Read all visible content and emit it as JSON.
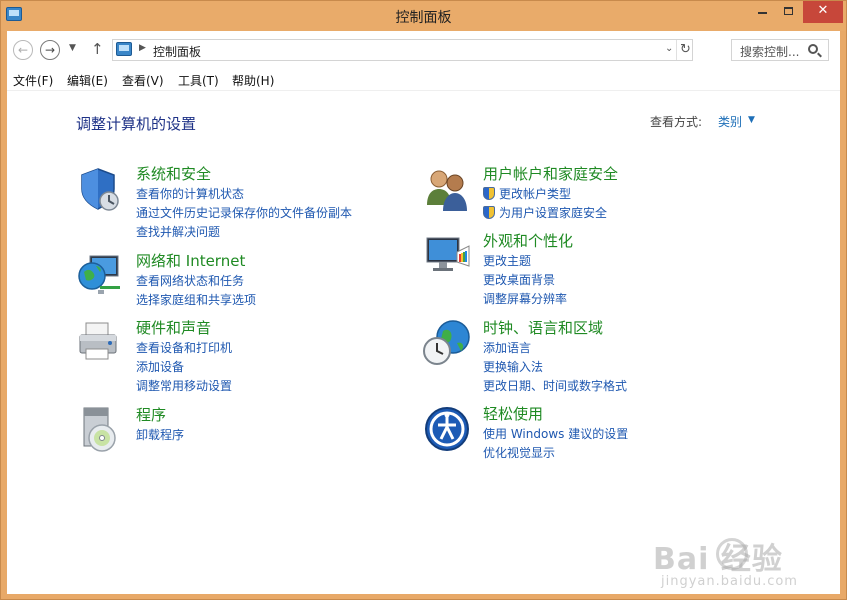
{
  "window": {
    "title": "控制面板",
    "controls": {
      "close": "✕"
    }
  },
  "address_bar": {
    "path": "控制面板",
    "search_placeholder": "搜索控制..."
  },
  "menu": [
    "文件(F)",
    "编辑(E)",
    "查看(V)",
    "工具(T)",
    "帮助(H)"
  ],
  "main": {
    "title": "调整计算机的设置",
    "view_by_label": "查看方式:",
    "view_by_value": "类别"
  },
  "categories": [
    {
      "title": "系统和安全",
      "icon": "shield-security-icon",
      "links": [
        "查看你的计算机状态",
        "通过文件历史记录保存你的文件备份副本",
        "查找并解决问题"
      ]
    },
    {
      "title": "网络和 Internet",
      "icon": "network-globe-icon",
      "links": [
        "查看网络状态和任务",
        "选择家庭组和共享选项"
      ]
    },
    {
      "title": "硬件和声音",
      "icon": "printer-hardware-icon",
      "links": [
        "查看设备和打印机",
        "添加设备",
        "调整常用移动设置"
      ]
    },
    {
      "title": "程序",
      "icon": "programs-disc-icon",
      "links": [
        "卸载程序"
      ]
    },
    {
      "title": "用户帐户和家庭安全",
      "icon": "users-icon",
      "links": [
        "更改帐户类型",
        "为用户设置家庭安全"
      ]
    },
    {
      "title": "外观和个性化",
      "icon": "monitor-palette-icon",
      "links": [
        "更改主题",
        "更改桌面背景",
        "调整屏幕分辨率"
      ]
    },
    {
      "title": "时钟、语言和区域",
      "icon": "clock-globe-icon",
      "links": [
        "添加语言",
        "更换输入法",
        "更改日期、时间或数字格式"
      ]
    },
    {
      "title": "轻松使用",
      "icon": "ease-of-access-icon",
      "links": [
        "使用 Windows 建议的设置",
        "优化视觉显示"
      ]
    }
  ],
  "watermark": {
    "logo": "Bai  经验",
    "url": "jingyan.baidu.com"
  }
}
